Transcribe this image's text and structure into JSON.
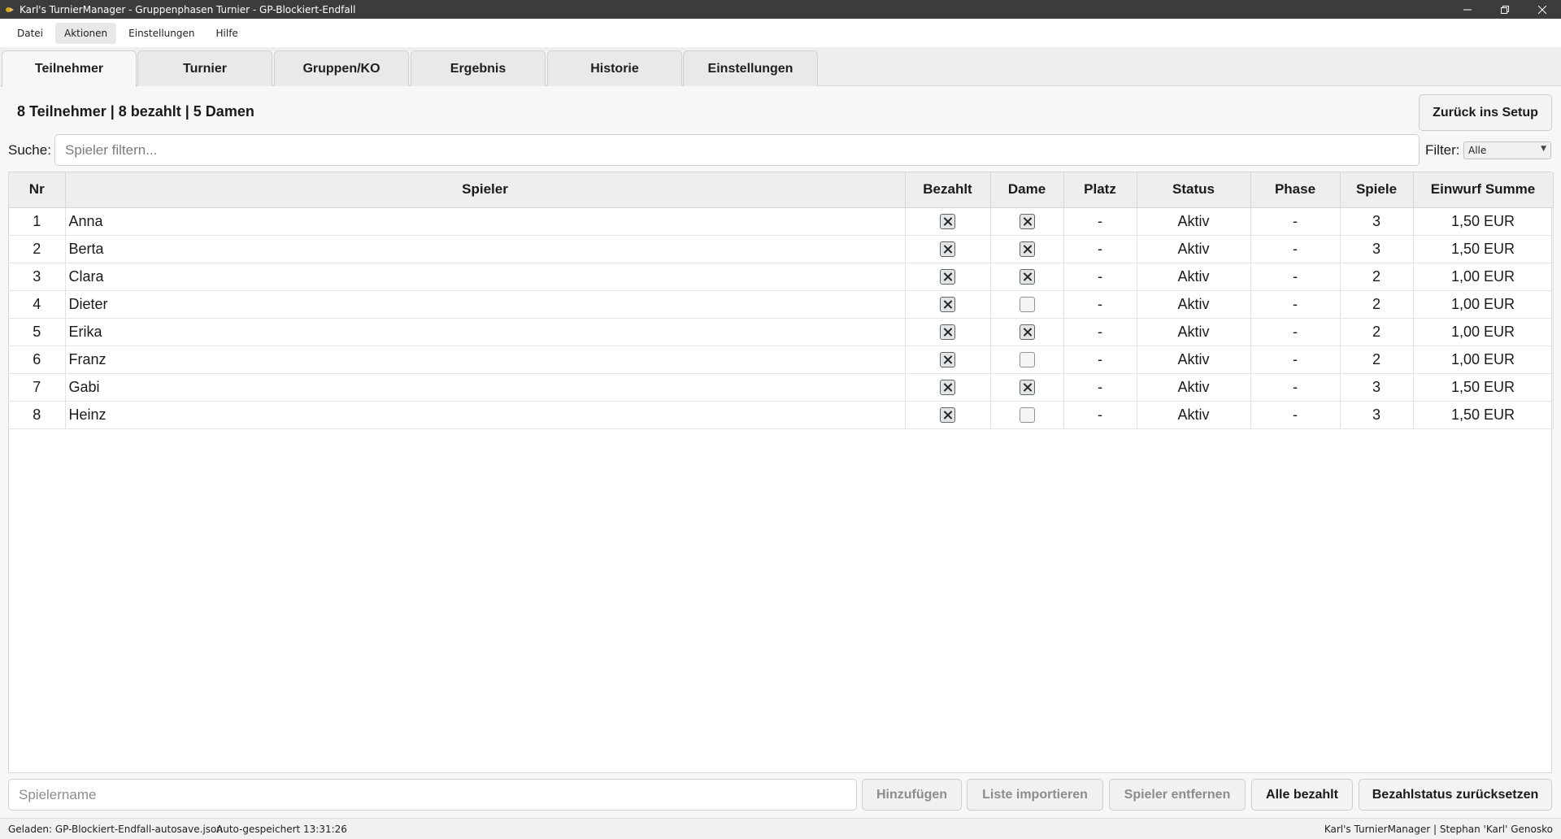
{
  "window": {
    "title": "Karl's TurnierManager - Gruppenphasen Turnier - GP-Blockiert-Endfall",
    "controls": [
      "minimize-icon",
      "restore-icon",
      "close-icon"
    ]
  },
  "menu": {
    "items": [
      {
        "label": "Datei"
      },
      {
        "label": "Aktionen",
        "active": true
      },
      {
        "label": "Einstellungen"
      },
      {
        "label": "Hilfe"
      }
    ]
  },
  "tabs": [
    {
      "label": "Teilnehmer",
      "active": true
    },
    {
      "label": "Turnier"
    },
    {
      "label": "Gruppen/KO"
    },
    {
      "label": "Ergebnis"
    },
    {
      "label": "Historie"
    },
    {
      "label": "Einstellungen"
    }
  ],
  "summary": "8 Teilnehmer | 8 bezahlt | 5 Damen",
  "back_button": "Zurück ins Setup",
  "search": {
    "label": "Suche:",
    "placeholder": "Spieler filtern..."
  },
  "filter": {
    "label": "Filter:",
    "value": "Alle"
  },
  "table": {
    "columns": [
      "Nr",
      "Spieler",
      "Bezahlt",
      "Dame",
      "Platz",
      "Status",
      "Phase",
      "Spiele",
      "Einwurf Summe"
    ],
    "rows": [
      {
        "nr": "1",
        "name": "Anna",
        "paid": true,
        "lady": true,
        "place": "-",
        "status": "Aktiv",
        "phase": "-",
        "games": "3",
        "sum": "1,50 EUR"
      },
      {
        "nr": "2",
        "name": "Berta",
        "paid": true,
        "lady": true,
        "place": "-",
        "status": "Aktiv",
        "phase": "-",
        "games": "3",
        "sum": "1,50 EUR"
      },
      {
        "nr": "3",
        "name": "Clara",
        "paid": true,
        "lady": true,
        "place": "-",
        "status": "Aktiv",
        "phase": "-",
        "games": "2",
        "sum": "1,00 EUR"
      },
      {
        "nr": "4",
        "name": "Dieter",
        "paid": true,
        "lady": false,
        "place": "-",
        "status": "Aktiv",
        "phase": "-",
        "games": "2",
        "sum": "1,00 EUR"
      },
      {
        "nr": "5",
        "name": "Erika",
        "paid": true,
        "lady": true,
        "place": "-",
        "status": "Aktiv",
        "phase": "-",
        "games": "2",
        "sum": "1,00 EUR"
      },
      {
        "nr": "6",
        "name": "Franz",
        "paid": true,
        "lady": false,
        "place": "-",
        "status": "Aktiv",
        "phase": "-",
        "games": "2",
        "sum": "1,00 EUR"
      },
      {
        "nr": "7",
        "name": "Gabi",
        "paid": true,
        "lady": true,
        "place": "-",
        "status": "Aktiv",
        "phase": "-",
        "games": "3",
        "sum": "1,50 EUR"
      },
      {
        "nr": "8",
        "name": "Heinz",
        "paid": true,
        "lady": false,
        "place": "-",
        "status": "Aktiv",
        "phase": "-",
        "games": "3",
        "sum": "1,50 EUR"
      }
    ]
  },
  "bottom": {
    "name_placeholder": "Spielername",
    "add": "Hinzufügen",
    "import": "Liste importieren",
    "remove": "Spieler entfernen",
    "all_paid": "Alle bezahlt",
    "reset_paid": "Bezahlstatus zurücksetzen"
  },
  "statusbar": {
    "loaded": "Geladen: GP-Blockiert-Endfall-autosave.json",
    "autosaved": "Auto-gespeichert 13:31:26",
    "credits": "Karl's TurnierManager | Stephan 'Karl' Genosko"
  }
}
